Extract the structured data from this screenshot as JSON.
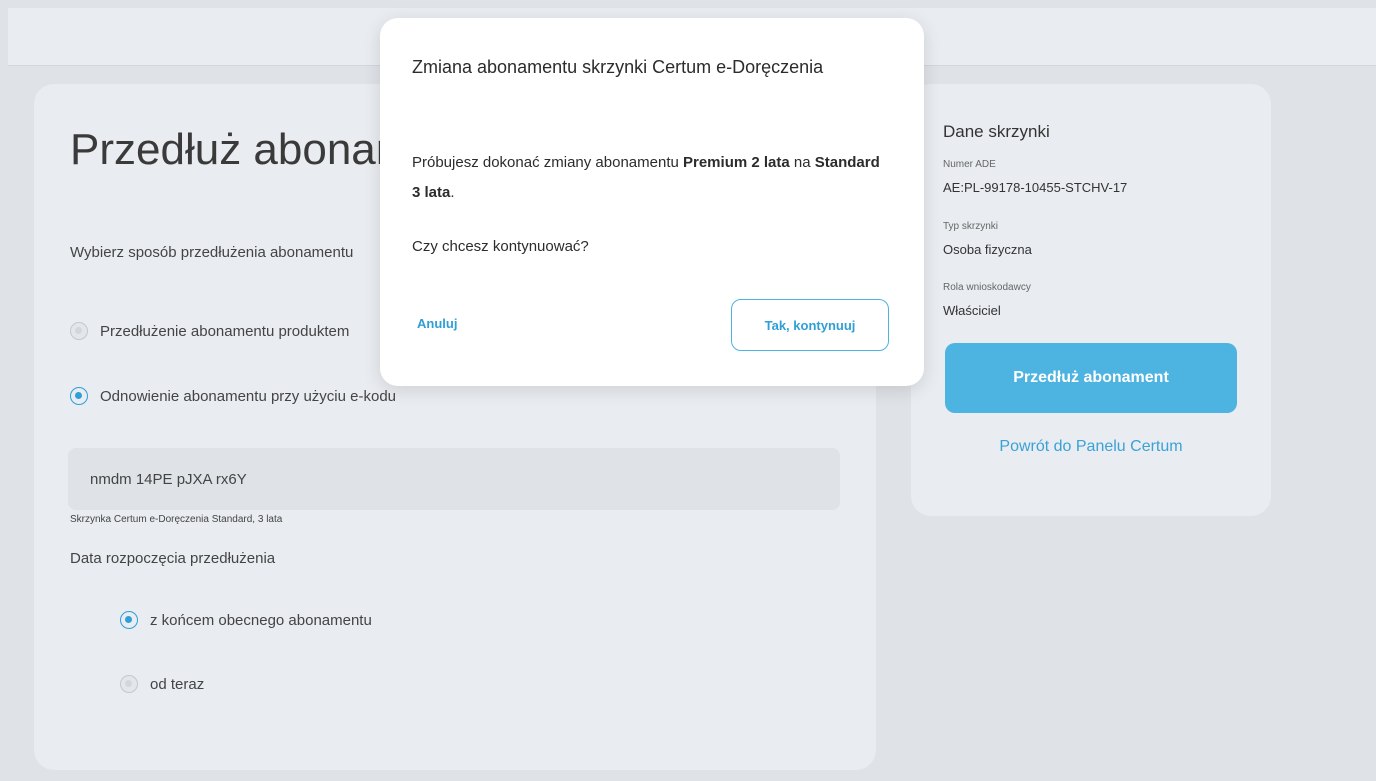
{
  "main": {
    "title": "Przedłuż abonament skrzynki",
    "subtitle": "Wybierz sposób przedłużenia abonamentu",
    "options": [
      {
        "label": "Przedłużenie abonamentu produktem",
        "selected": false
      },
      {
        "label": "Odnowienie abonamentu przy użyciu e-kodu",
        "selected": true
      }
    ],
    "ecode_value": "nmdm 14PE pJXA rx6Y",
    "ecode_hint": "Skrzynka Certum e-Doręczenia Standard, 3 lata",
    "date_label": "Data rozpoczęcia przedłużenia",
    "date_options": [
      {
        "label": "z końcem obecnego abonamentu",
        "selected": true
      },
      {
        "label": "od teraz",
        "selected": false
      }
    ]
  },
  "side": {
    "title": "Dane skrzynki",
    "fields": [
      {
        "label": "Numer ADE",
        "value": "AE:PL-99178-10455-STCHV-17"
      },
      {
        "label": "Typ skrzynki",
        "value": "Osoba fizyczna"
      },
      {
        "label": "Rola wnioskodawcy",
        "value": "Właściciel"
      }
    ],
    "extend_button": "Przedłuż abonament",
    "back_link": "Powrót do Panelu Certum"
  },
  "modal": {
    "title": "Zmiana abonamentu skrzynki Certum e-Doręczenia",
    "msg_prefix": "Próbujesz dokonać zmiany abonamentu ",
    "msg_from": "Premium 2 lata",
    "msg_middle": " na ",
    "msg_to": "Standard 3 lata",
    "msg_suffix": ".",
    "question": "Czy chcesz kontynuować?",
    "cancel": "Anuluj",
    "confirm": "Tak, kontynuuj"
  },
  "colors": {
    "accent": "#4db3e0",
    "link": "#2f9fd6",
    "background": "#dfe2e7",
    "card": "#e9ecf0"
  }
}
